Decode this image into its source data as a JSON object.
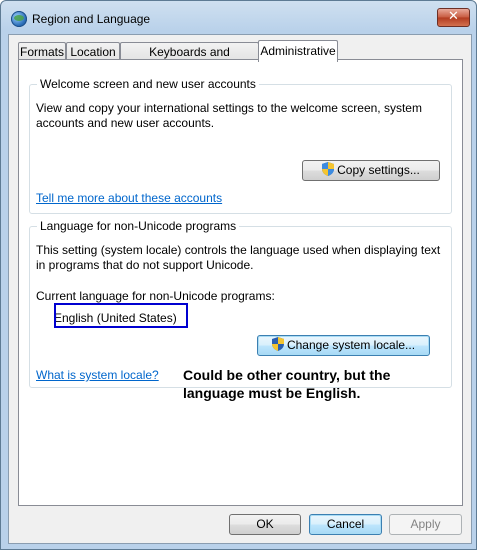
{
  "window": {
    "title": "Region and Language",
    "close_glyph": "✕"
  },
  "tabs": [
    {
      "label": "Formats"
    },
    {
      "label": "Location"
    },
    {
      "label": "Keyboards and Languages"
    },
    {
      "label": "Administrative"
    }
  ],
  "welcome_group": {
    "label": "Welcome screen and new user accounts",
    "description": "View and copy your international settings to the welcome screen, system accounts and new user accounts.",
    "copy_button": "Copy settings...",
    "link": "Tell me more about these accounts"
  },
  "unicode_group": {
    "label": "Language for non-Unicode programs",
    "description": "This setting (system locale) controls the language used when displaying text in programs that do not support Unicode.",
    "current_label": "Current language for non-Unicode programs:",
    "current_value": "English (United States)",
    "change_button": "Change system locale...",
    "link": "What is system locale?"
  },
  "annotation": {
    "line1": "Could be other country, but the",
    "line2": "language must be English."
  },
  "footer": {
    "ok": "OK",
    "cancel": "Cancel",
    "apply": "Apply"
  },
  "colors": {
    "link": "#0066cc",
    "highlight": "#0000d0",
    "close": "#c75a3f"
  }
}
